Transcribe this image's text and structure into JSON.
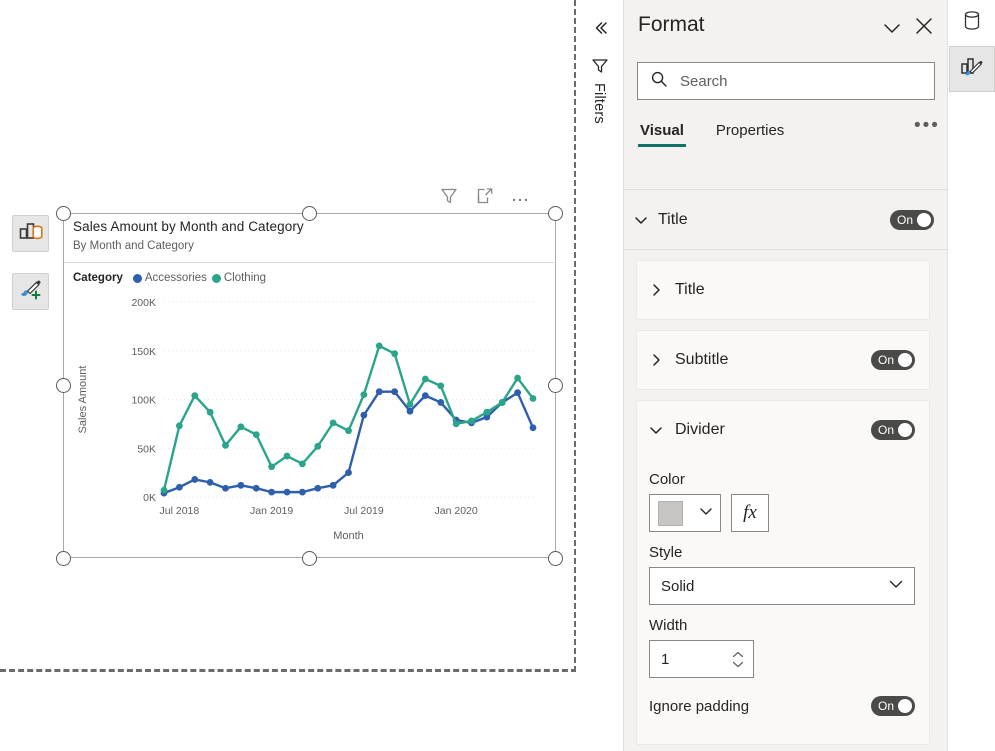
{
  "canvas": {
    "visual": {
      "title": "Sales Amount by Month and Category",
      "subtitle": "By Month and Category",
      "header_icons": [
        "filter-icon",
        "focus-mode-icon",
        "more-options-icon"
      ]
    },
    "floating_buttons": [
      {
        "name": "build-visual-button",
        "icon": "build-visual-icon"
      },
      {
        "name": "format-visual-button",
        "icon": "format-paintbrush-icon"
      }
    ]
  },
  "filters_rail": {
    "collapse_label": "collapse-pane-icon",
    "filter_icon": "filter-funnel-icon",
    "label": "Filters"
  },
  "format_pane": {
    "title": "Format",
    "chevron_icon": "chevron-down-icon",
    "close_icon": "close-icon",
    "search": {
      "placeholder": "Search",
      "value": "",
      "icon": "search-icon"
    },
    "tabs": [
      {
        "label": "Visual",
        "active": true
      },
      {
        "label": "Properties",
        "active": false
      }
    ],
    "more_label": "•••",
    "sections": [
      {
        "name": "Title",
        "expanded": true,
        "toggle": {
          "state": "On"
        },
        "cards": [
          {
            "name": "Title",
            "expanded": false,
            "toggle": null
          },
          {
            "name": "Subtitle",
            "expanded": false,
            "toggle": {
              "state": "On"
            }
          },
          {
            "name": "Divider",
            "expanded": true,
            "toggle": {
              "state": "On"
            },
            "fields": {
              "color_label": "Color",
              "color_value": "#C8C6C4",
              "fx_label": "fx",
              "style_label": "Style",
              "style_value": "Solid",
              "width_label": "Width",
              "width_value": "1",
              "ignore_padding_label": "Ignore padding",
              "ignore_padding_state": "On"
            }
          }
        ]
      }
    ]
  },
  "icon_rail": [
    {
      "name": "data-pane-button",
      "icon": "database-cylinder-icon",
      "selected": false
    },
    {
      "name": "format-pane-button",
      "icon": "format-visual-icon",
      "selected": true
    }
  ],
  "chart_data": {
    "type": "line",
    "title": "Sales Amount by Month and Category",
    "subtitle": "By Month and Category",
    "xlabel": "Month",
    "ylabel": "Sales Amount",
    "ylim": [
      0,
      200000
    ],
    "yticks": [
      0,
      50000,
      100000,
      150000,
      200000
    ],
    "ytick_labels": [
      "0K",
      "50K",
      "100K",
      "150K",
      "200K"
    ],
    "grid": true,
    "legend_title": "Category",
    "legend_position": "top-left",
    "x": [
      "Jun 2018",
      "Jul 2018",
      "Aug 2018",
      "Sep 2018",
      "Oct 2018",
      "Nov 2018",
      "Dec 2018",
      "Jan 2019",
      "Feb 2019",
      "Mar 2019",
      "Apr 2019",
      "May 2019",
      "Jun 2019",
      "Jul 2019",
      "Aug 2019",
      "Sep 2019",
      "Oct 2019",
      "Nov 2019",
      "Dec 2019",
      "Jan 2020",
      "Feb 2020",
      "Mar 2020",
      "Apr 2020",
      "May 2020",
      "Jun 2020"
    ],
    "xtick_labels": [
      "Jul 2018",
      "Jan 2019",
      "Jul 2019",
      "Jan 2020"
    ],
    "xtick_indices": [
      1,
      7,
      13,
      19
    ],
    "series": [
      {
        "name": "Accessories",
        "color": "#2E5FAC",
        "values": [
          4000,
          10000,
          18000,
          15000,
          9000,
          12000,
          9000,
          5000,
          5000,
          5000,
          9000,
          12000,
          25000,
          84000,
          108000,
          108000,
          88000,
          104000,
          97000,
          79000,
          76000,
          82000,
          97000,
          107000,
          71000
        ]
      },
      {
        "name": "Clothing",
        "color": "#2BA58A",
        "values": [
          7000,
          73000,
          104000,
          87000,
          53000,
          72000,
          64000,
          31000,
          42000,
          34000,
          52000,
          76000,
          68000,
          105000,
          155000,
          147000,
          95000,
          121000,
          114000,
          75000,
          78000,
          87000,
          97000,
          122000,
          101000
        ]
      }
    ]
  }
}
